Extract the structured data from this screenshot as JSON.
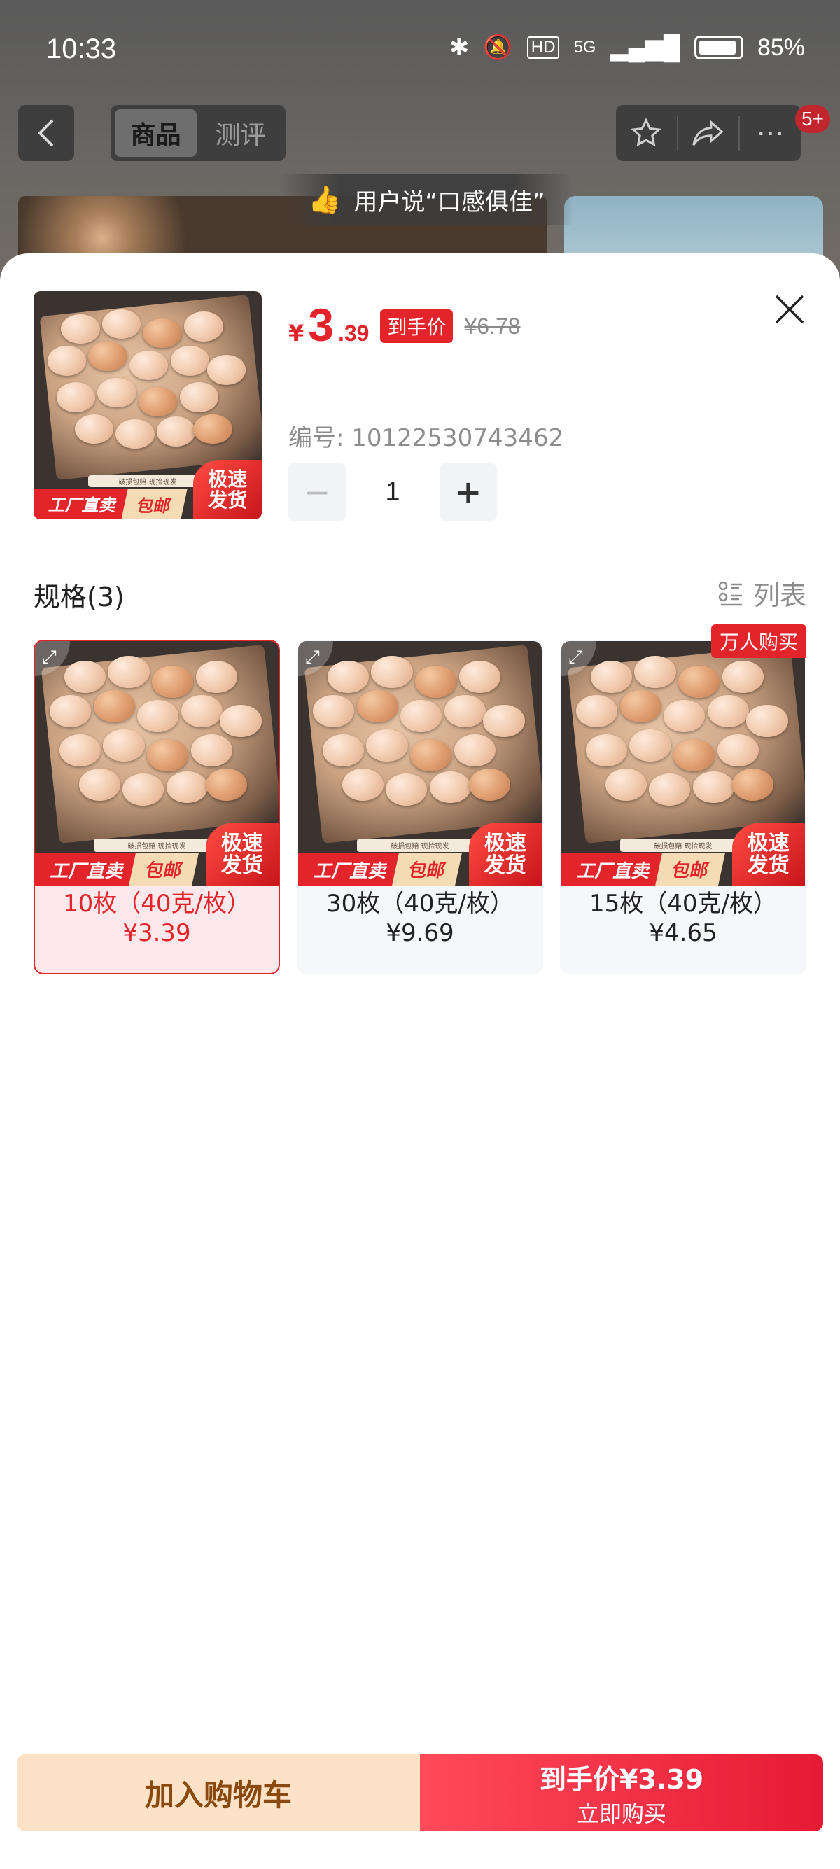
{
  "status_bar": {
    "time": "10:33",
    "network": "5G",
    "battery": "85%"
  },
  "header": {
    "back_icon": "chevron-left-icon",
    "tabs": [
      {
        "label": "商品",
        "active": true
      },
      {
        "label": "测评",
        "active": false
      }
    ],
    "actions": [
      "star-icon",
      "share-icon",
      "more-icon"
    ],
    "message_badge": "5+",
    "banner_tip": "用户说“口感俱佳”"
  },
  "product": {
    "currency": "¥",
    "price_int": "3",
    "price_dec": ".39",
    "price_badge": "到手价",
    "original_price": "¥6.78",
    "sku_code": "编号: 10122530743462",
    "quantity": "1",
    "image_texts": {
      "strip_top": "破损包赔  现捡现发",
      "strip_red": "工厂直卖",
      "strip_yellow": "包邮",
      "strip_fast": "极速\n发货"
    }
  },
  "specs": {
    "title": "规格(3)",
    "list_toggle": "列表",
    "options": [
      {
        "label": "10枚（40克/枚）",
        "price": "¥3.39",
        "selected": true,
        "tag": ""
      },
      {
        "label": "30枚（40克/枚）",
        "price": "¥9.69",
        "selected": false,
        "tag": ""
      },
      {
        "label": "15枚（40克/枚）",
        "price": "¥4.65",
        "selected": false,
        "tag": "万人购买"
      }
    ]
  },
  "bottom_bar": {
    "add_to_cart": "加入购物车",
    "buy_top": "到手价¥3.39",
    "buy_bottom": "立即购买"
  },
  "colors": {
    "accent": "#e4242b",
    "cart_bg": "#fde2c8",
    "cart_text": "#8a4a0f"
  }
}
